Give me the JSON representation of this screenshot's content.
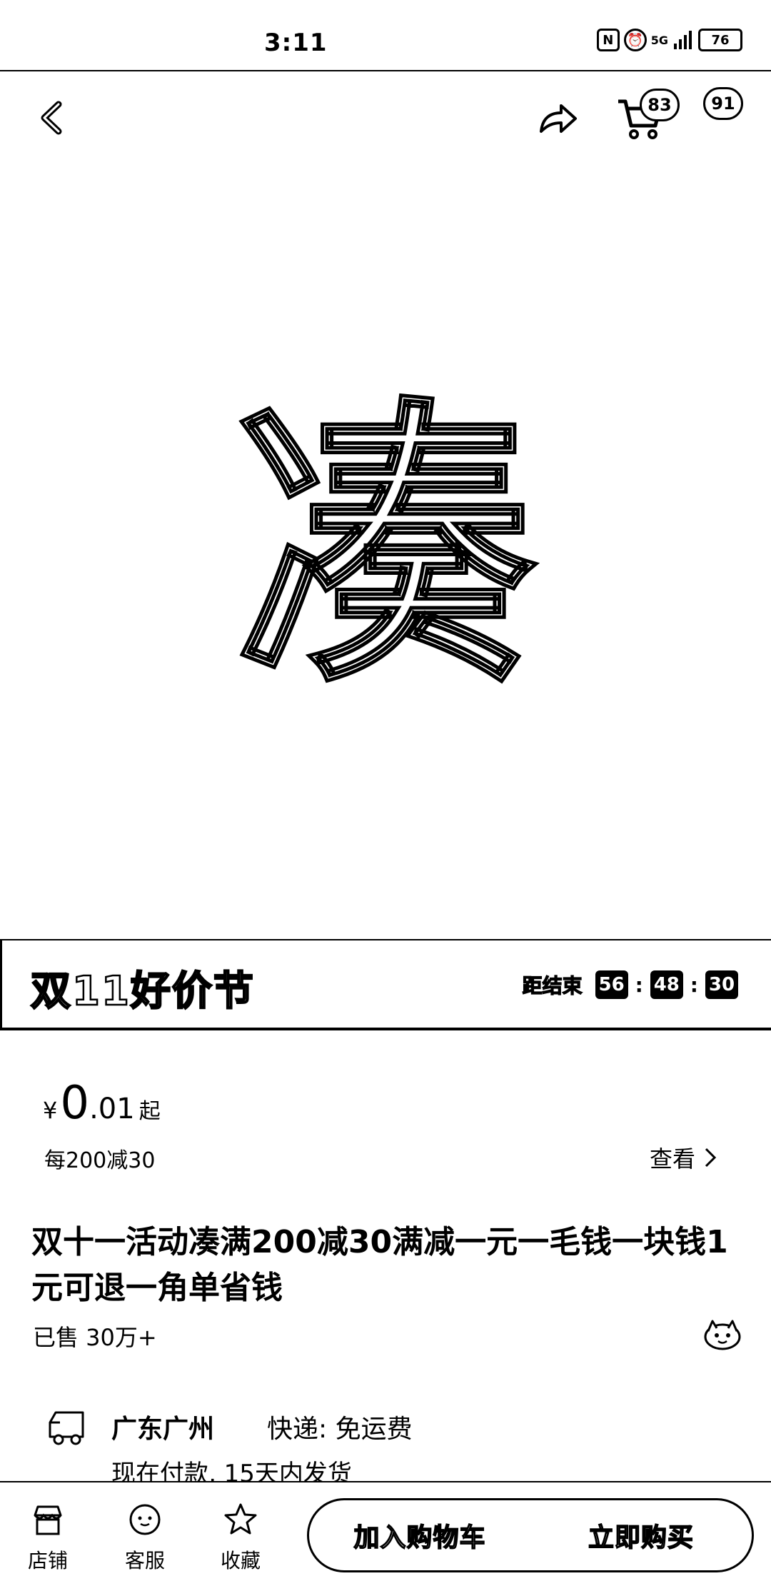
{
  "status_bar": {
    "time": "3:11",
    "network": "5G",
    "battery": "76"
  },
  "nav": {
    "cart_badge": "83",
    "message_badge": "91"
  },
  "hero": {
    "character": "凑"
  },
  "promo": {
    "title": "双11好价节",
    "countdown_label": "距结束",
    "hours": "56",
    "minutes": "48",
    "seconds": "30"
  },
  "price": {
    "currency": "¥",
    "integer": "0",
    "decimal": ".01",
    "suffix": "起",
    "discount": "每200减30",
    "view_label": "查看"
  },
  "product": {
    "title": "双十一活动凑满200减30满减一元一毛钱一块钱1元可退一角单省钱",
    "sold": "已售 30万+"
  },
  "shipping": {
    "location": "广东广州",
    "method": "快递: 免运费",
    "time": "现在付款, 15天内发货"
  },
  "bottom_bar": {
    "store": "店铺",
    "service": "客服",
    "favorite": "收藏",
    "add_to_cart": "加入购物车",
    "buy_now": "立即购买"
  }
}
